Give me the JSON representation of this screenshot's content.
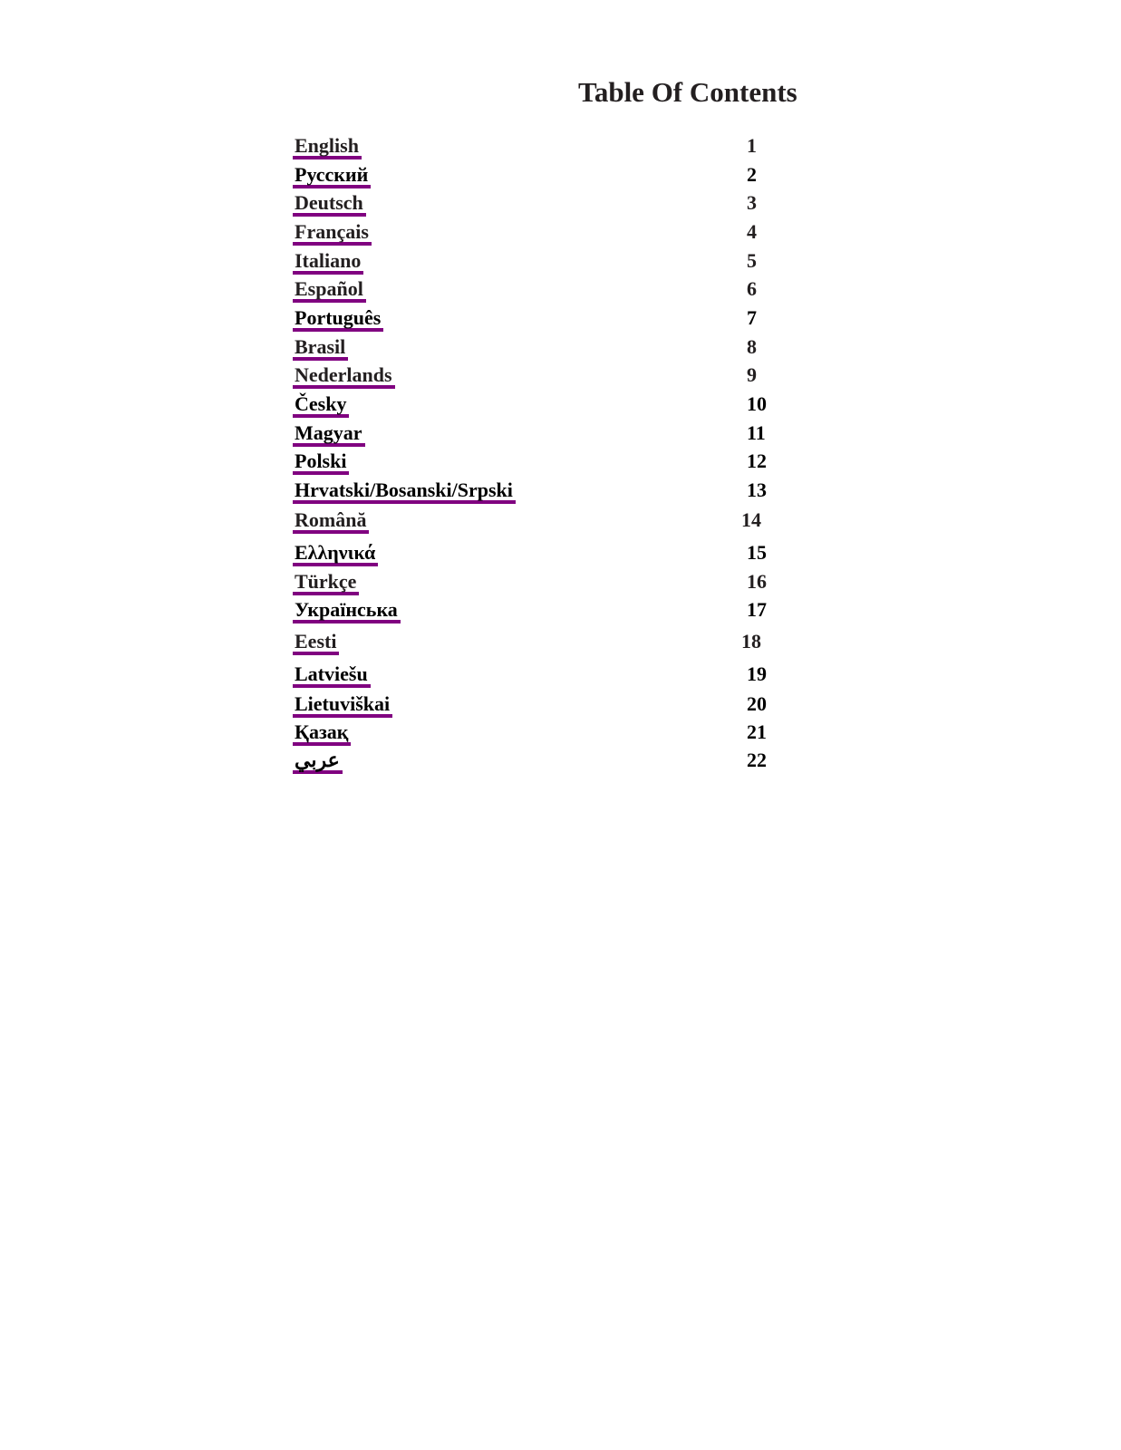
{
  "title": "Table Of Contents",
  "link_color": "#800080",
  "entries": [
    {
      "label": "English",
      "page": "1"
    },
    {
      "label": "Русский",
      "page": "2"
    },
    {
      "label": "Deutsch",
      "page": "3"
    },
    {
      "label": "Français",
      "page": "4"
    },
    {
      "label": "Italiano",
      "page": "5"
    },
    {
      "label": "Español",
      "page": "6"
    },
    {
      "label": "Português",
      "page": "7"
    },
    {
      "label": "Brasil",
      "page": "8"
    },
    {
      "label": "Nederlands",
      "page": "9"
    },
    {
      "label": "Česky",
      "page": "10"
    },
    {
      "label": "Magyar",
      "page": "11"
    },
    {
      "label": "Polski",
      "page": "12"
    },
    {
      "label": "Hrvatski/Bosanski/Srpski",
      "page": "13"
    },
    {
      "label": "Română",
      "page": "14"
    },
    {
      "label": "Ελληνικά",
      "page": "15"
    },
    {
      "label": "Türkçe",
      "page": "16"
    },
    {
      "label": "Українська",
      "page": "17"
    },
    {
      "label": "Eesti",
      "page": "18"
    },
    {
      "label": "Latviešu",
      "page": "19"
    },
    {
      "label": "Lietuviškai",
      "page": "20"
    },
    {
      "label": " Қазақ",
      "page": "21"
    },
    {
      "label": "عربي",
      "page": "22"
    }
  ]
}
